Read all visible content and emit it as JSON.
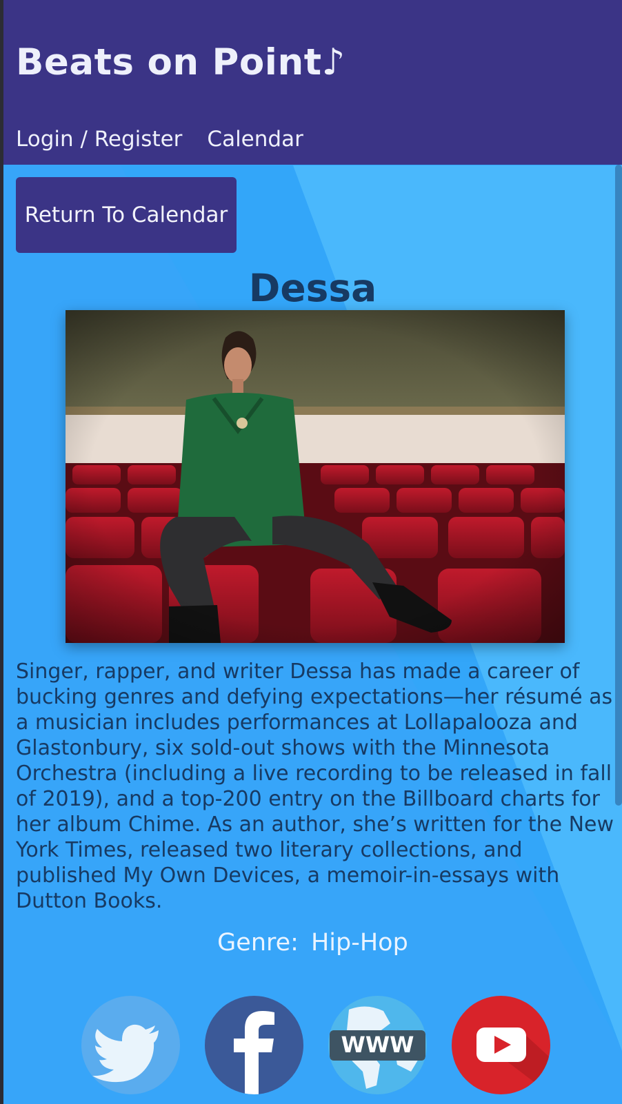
{
  "header": {
    "site_title": "Beats on Point♪",
    "nav": [
      {
        "label": "Login / Register"
      },
      {
        "label": "Calendar"
      }
    ]
  },
  "actions": {
    "return_label": "Return To Calendar"
  },
  "artist": {
    "name": "Dessa",
    "bio": "Singer, rapper, and writer Dessa has made a career of bucking genres and defying expectations—her résumé as a musician includes performances at Lollapalooza and Glastonbury, six sold-out shows with the Minnesota Orchestra (including a live recording to be released in fall of 2019), and a top-200 entry on the Billboard charts for her album Chime. As an author, she’s written for the New York Times, released two literary collections, and published My Own Devices, a memoir-in-essays with Dutton Books.",
    "genre_label": "Genre:",
    "genre_value": "Hip-Hop"
  },
  "social": [
    {
      "icon": "twitter-icon",
      "color": "#5aacee"
    },
    {
      "icon": "facebook-icon",
      "color": "#3b5998"
    },
    {
      "icon": "website-icon",
      "color": "#4fb7ec"
    },
    {
      "icon": "youtube-icon",
      "color": "#d8232a"
    }
  ],
  "colors": {
    "header_bg": "#3b3486",
    "page_bg": "#37a5f9",
    "text_dark": "#173a63"
  }
}
